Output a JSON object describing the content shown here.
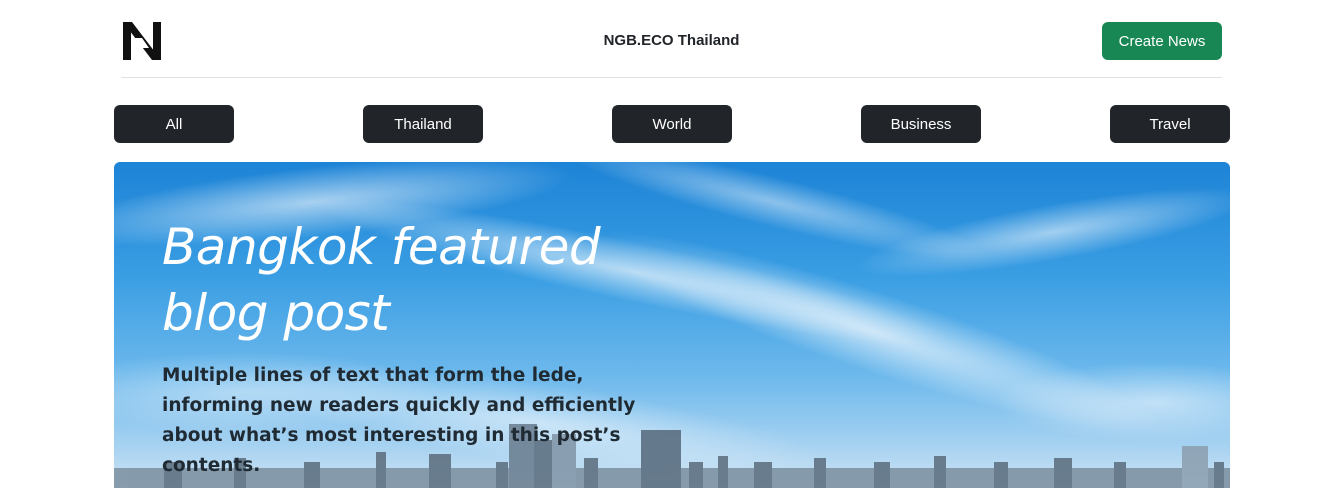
{
  "header": {
    "site_title": "NGB.ECO Thailand",
    "create_button": "Create News",
    "logo_icon": "ngb-logo-icon"
  },
  "categories": [
    {
      "label": "All"
    },
    {
      "label": "Thailand"
    },
    {
      "label": "World"
    },
    {
      "label": "Business"
    },
    {
      "label": "Travel"
    }
  ],
  "hero": {
    "title": "Bangkok featured blog post",
    "lede": "Multiple lines of text that form the lede, informing new readers quickly and efficiently about what’s most interesting in this post’s contents."
  },
  "colors": {
    "create_button_bg": "#198754",
    "category_bg": "#212529",
    "sky_top": "#1d83d6"
  }
}
